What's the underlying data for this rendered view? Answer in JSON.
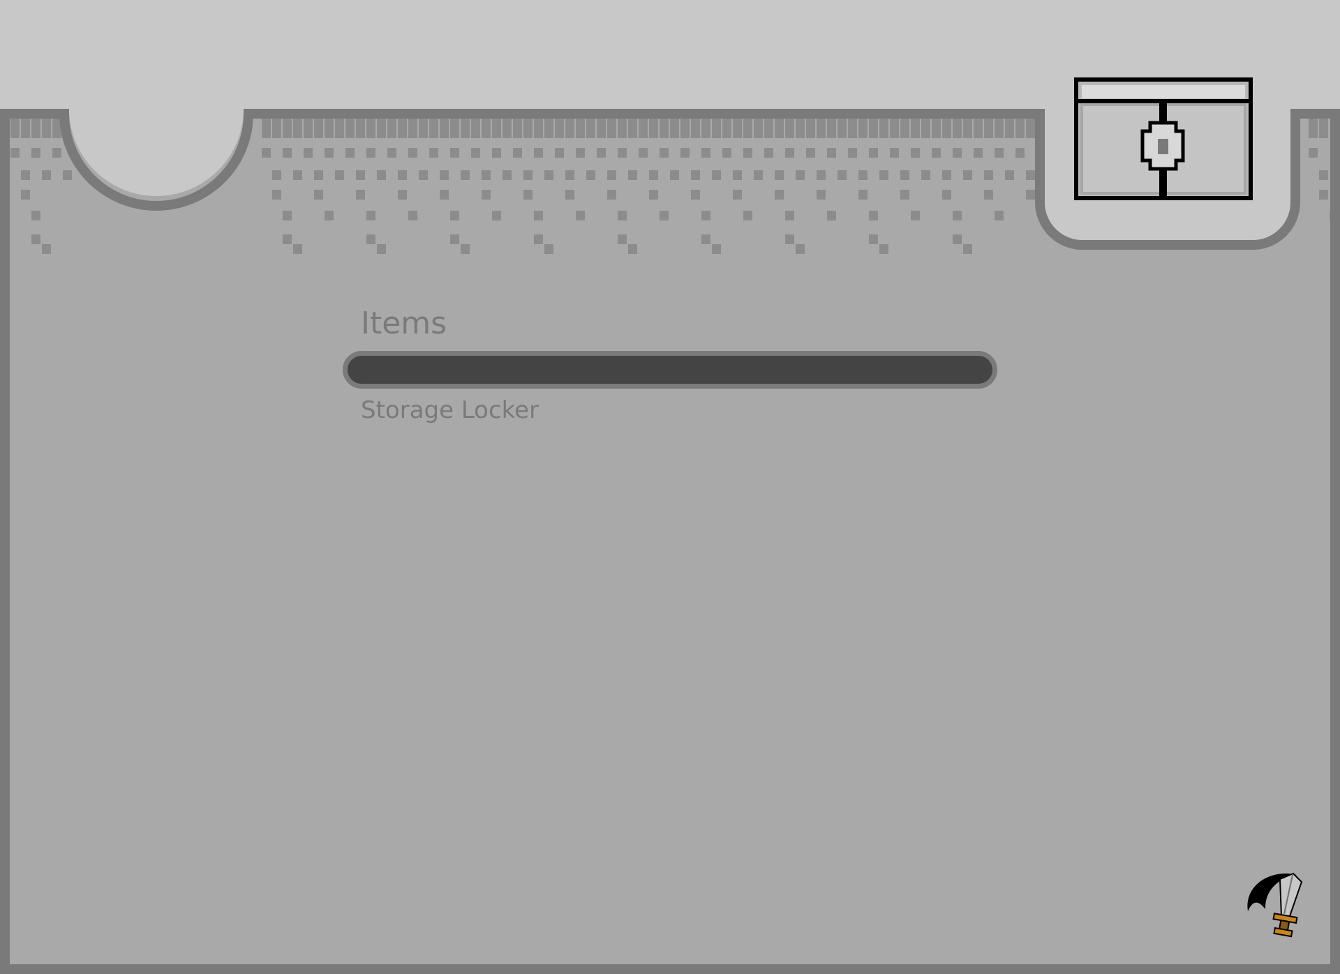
{
  "colors": {
    "sky": "#c8c8c8",
    "panel": "#a9a9a9",
    "panel_border": "#7a7a7a",
    "pattern": "#8c8c8c",
    "bar_fill": "#444444",
    "text": "#7a7a7a"
  },
  "header": {
    "left_tab": "empty-round-tab",
    "right_tab_icon": "treasure-chest-icon"
  },
  "inventory": {
    "section_title": "Items",
    "items": [
      {
        "label": "Storage Locker"
      }
    ]
  },
  "corner_icon": "sword-icon"
}
